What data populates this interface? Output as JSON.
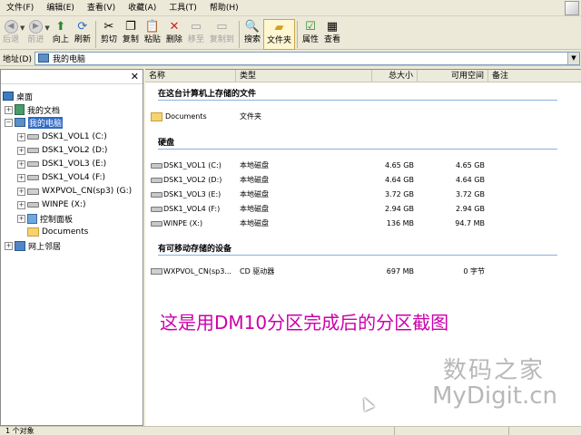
{
  "menubar": {
    "items": [
      "文件(F)",
      "编辑(E)",
      "查看(V)",
      "收藏(A)",
      "工具(T)",
      "帮助(H)"
    ]
  },
  "toolbar": {
    "back": "后退",
    "forward": "前进",
    "up": "向上",
    "refresh": "刷新",
    "cut": "剪切",
    "copy": "复制",
    "paste": "粘贴",
    "delete": "删除",
    "move": "移至",
    "copy_to": "复制到",
    "search": "搜索",
    "folders": "文件夹",
    "properties": "属性",
    "view": "查看"
  },
  "address": {
    "label": "地址(D)",
    "value": "我的电脑"
  },
  "tree": {
    "items": [
      {
        "label": "桌面"
      },
      {
        "label": "我的文档"
      },
      {
        "label": "我的电脑"
      },
      {
        "label": "DSK1_VOL1 (C:)"
      },
      {
        "label": "DSK1_VOL2 (D:)"
      },
      {
        "label": "DSK1_VOL3 (E:)"
      },
      {
        "label": "DSK1_VOL4 (F:)"
      },
      {
        "label": "WXPVOL_CN(sp3) (G:)"
      },
      {
        "label": "WINPE (X:)"
      },
      {
        "label": "控制面板"
      },
      {
        "label": "Documents"
      },
      {
        "label": "网上邻居"
      }
    ]
  },
  "list": {
    "columns": {
      "name": "名称",
      "type": "类型",
      "total": "总大小",
      "free": "可用空间",
      "notes": "备注"
    },
    "groups": {
      "stored": "在这台计算机上存储的文件",
      "hdd": "硬盘",
      "removable": "有可移动存储的设备"
    },
    "stored_rows": [
      {
        "name": "Documents",
        "type": "文件夹",
        "total": "",
        "free": ""
      }
    ],
    "hdd_rows": [
      {
        "name": "DSK1_VOL1 (C:)",
        "type": "本地磁盘",
        "total": "4.65 GB",
        "free": "4.65 GB"
      },
      {
        "name": "DSK1_VOL2 (D:)",
        "type": "本地磁盘",
        "total": "4.64 GB",
        "free": "4.64 GB"
      },
      {
        "name": "DSK1_VOL3 (E:)",
        "type": "本地磁盘",
        "total": "3.72 GB",
        "free": "3.72 GB"
      },
      {
        "name": "DSK1_VOL4 (F:)",
        "type": "本地磁盘",
        "total": "2.94 GB",
        "free": "2.94 GB"
      },
      {
        "name": "WINPE (X:)",
        "type": "本地磁盘",
        "total": "136 MB",
        "free": "94.7 MB"
      }
    ],
    "removable_rows": [
      {
        "name": "WXPVOL_CN(sp3...",
        "type": "CD 驱动器",
        "total": "697 MB",
        "free": "0 字节"
      }
    ]
  },
  "caption": "这是用DM10分区完成后的分区截图",
  "watermark": {
    "line1": "数码之家",
    "line2": "MyDigit.cn"
  },
  "status": {
    "text": "1 个对象"
  },
  "colors": {
    "caption": "#cc00aa",
    "selection": "#316ac5",
    "group_line": "#8ab0de"
  }
}
